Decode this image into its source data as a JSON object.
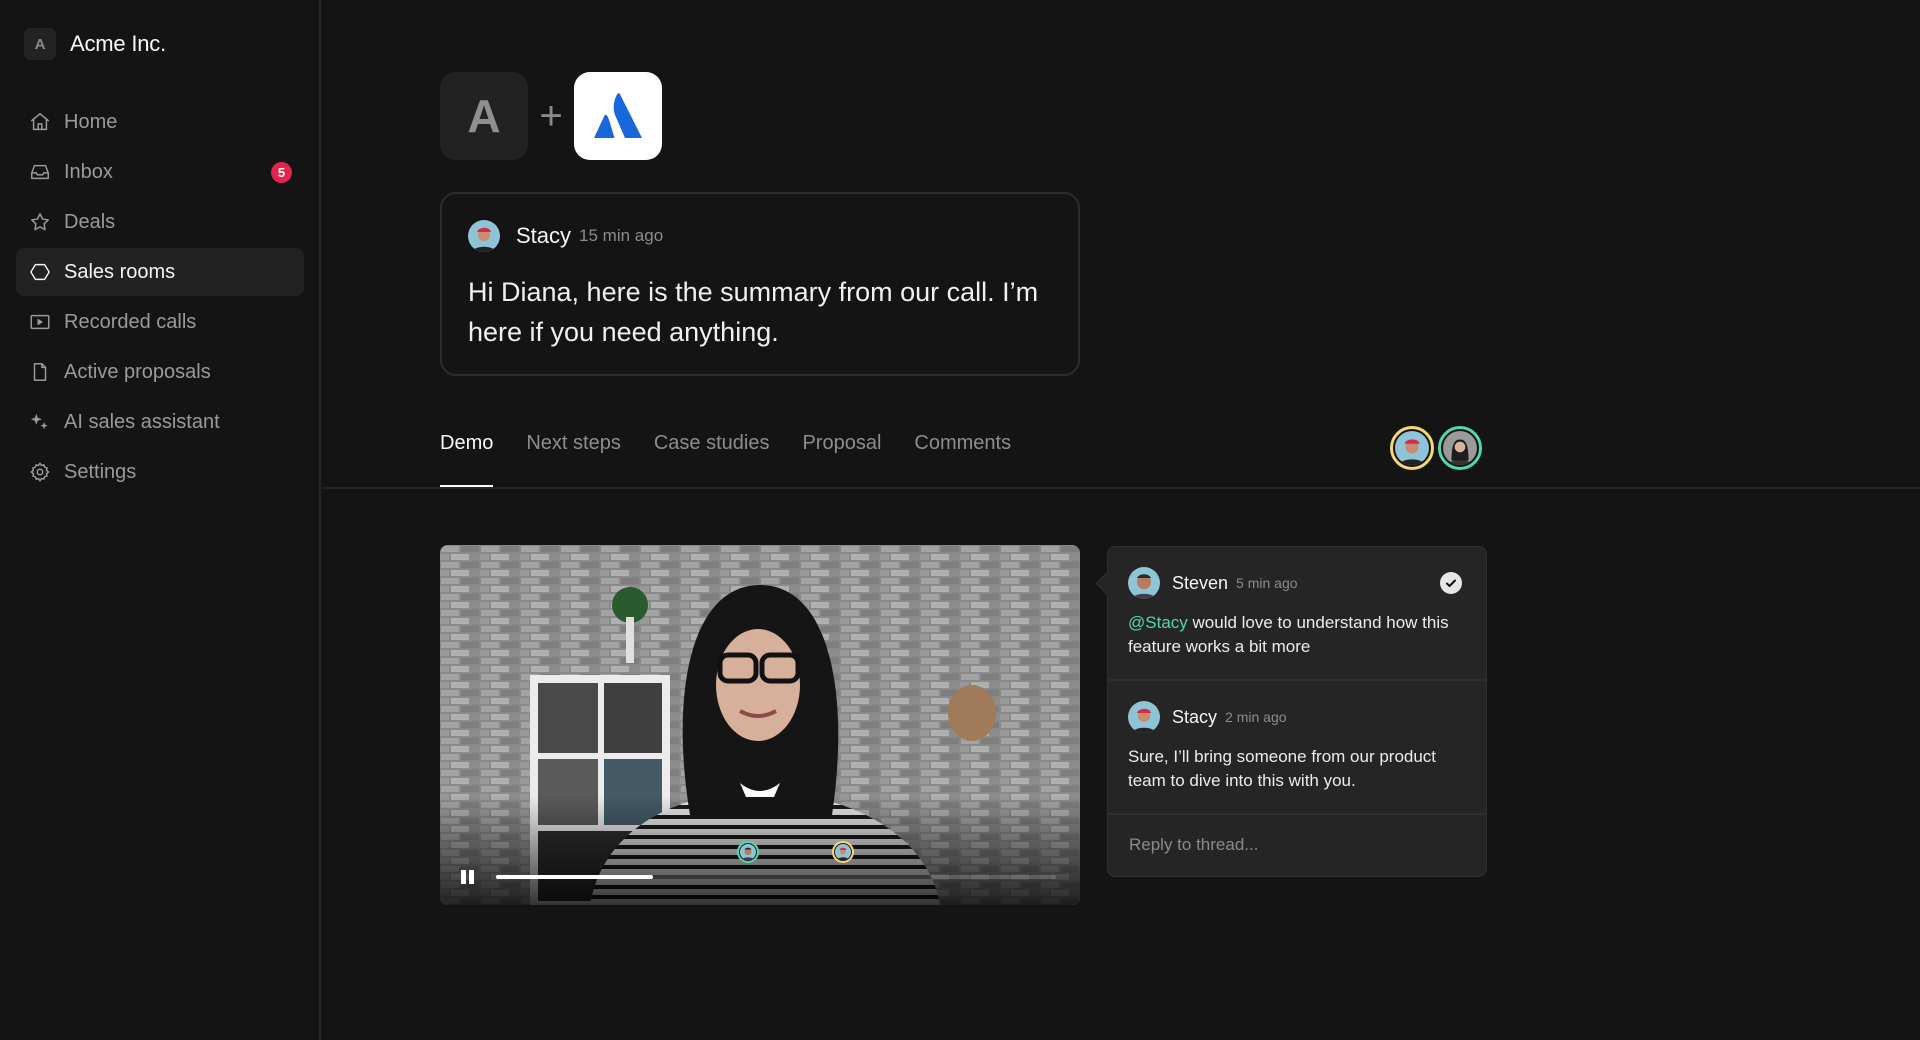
{
  "brand": {
    "logo_letter": "A",
    "name": "Acme Inc."
  },
  "sidebar": {
    "items": [
      {
        "label": "Home",
        "icon": "home-icon",
        "active": false
      },
      {
        "label": "Inbox",
        "icon": "inbox-icon",
        "active": false,
        "badge": "5"
      },
      {
        "label": "Deals",
        "icon": "star-icon",
        "active": false
      },
      {
        "label": "Sales rooms",
        "icon": "hexagon-icon",
        "active": true
      },
      {
        "label": "Recorded calls",
        "icon": "video-icon",
        "active": false
      },
      {
        "label": "Active proposals",
        "icon": "file-icon",
        "active": false
      },
      {
        "label": "AI sales assistant",
        "icon": "sparkles-icon",
        "active": false
      },
      {
        "label": "Settings",
        "icon": "gear-icon",
        "active": false
      }
    ],
    "badge_color": "#e5234f"
  },
  "header": {
    "company_logo_letter": "A",
    "plus": "+",
    "partner_logo": "atlassian-logo",
    "partner_color": "#1868db"
  },
  "message": {
    "author": "Stacy",
    "time": "15 min ago",
    "body": "Hi Diana, here is the summary from our call. I’m here if you need anything."
  },
  "tabs": [
    {
      "label": "Demo",
      "active": true
    },
    {
      "label": "Next steps",
      "active": false
    },
    {
      "label": "Case studies",
      "active": false
    },
    {
      "label": "Proposal",
      "active": false
    },
    {
      "label": "Comments",
      "active": false
    }
  ],
  "participants": [
    {
      "name": "Stacy",
      "ring_color": "#f5d77a"
    },
    {
      "name": "Diana",
      "ring_color": "#52d6b2"
    }
  ],
  "video": {
    "state": "playing",
    "progress": 0.28,
    "comment_markers": [
      {
        "author": "Steven",
        "position": 0.45,
        "ring_color": "#52d6b2"
      },
      {
        "author": "Stacy",
        "position": 0.62,
        "ring_color": "#f5d77a"
      }
    ]
  },
  "thread": {
    "comments": [
      {
        "author": "Steven",
        "time": "5 min ago",
        "mention": "@Stacy",
        "body": " would love to understand how this feature works a bit more",
        "resolved_icon": "check-circle-icon"
      },
      {
        "author": "Stacy",
        "time": "2 min ago",
        "body": "Sure, I’ll bring someone from our product team to dive into this with you."
      }
    ],
    "reply_placeholder": "Reply to thread...",
    "mention_color": "#52d6b2"
  }
}
